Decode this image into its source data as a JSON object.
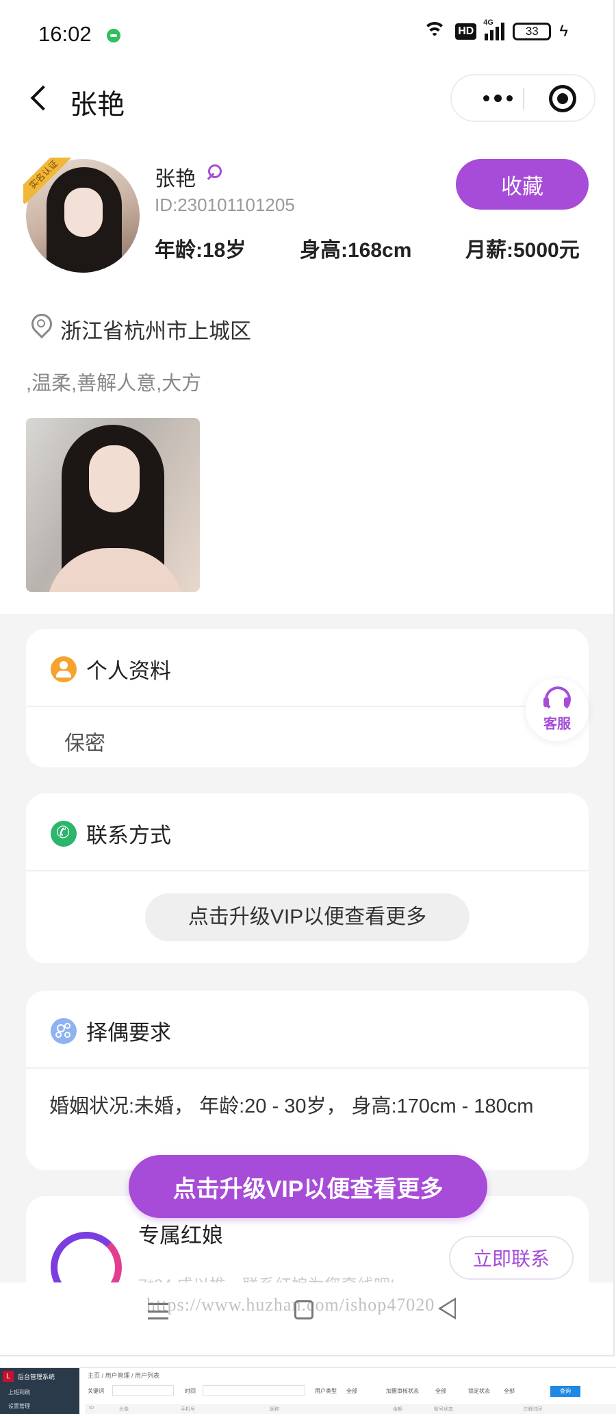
{
  "status_bar": {
    "time": "16:02",
    "hd": "HD",
    "network": "4G",
    "battery": "33",
    "icons": [
      "message-dot-icon",
      "wifi-icon",
      "hd-icon",
      "signal-icon",
      "battery-icon",
      "charging-icon"
    ]
  },
  "nav": {
    "title": "张艳",
    "icons": [
      "back-icon",
      "more-icon",
      "target-icon"
    ]
  },
  "profile": {
    "name": "张艳",
    "verify_badge": "实名认证",
    "id": "ID:230101101205",
    "favorite_label": "收藏",
    "age": "年龄:18岁",
    "height": "身高:168cm",
    "salary": "月薪:5000元",
    "location": "浙江省杭州市上城区",
    "tags": ",温柔,善解人意,大方"
  },
  "personal_info": {
    "title": "个人资料",
    "content": "保密"
  },
  "contact": {
    "title": "联系方式",
    "vip_prompt": "点击升级VIP以便查看更多"
  },
  "partner_requirements": {
    "title": "择偶要求",
    "content": "婚姻状况:未婚， 年龄:20 - 30岁， 身高:170cm - 180cm"
  },
  "matchmaker": {
    "title": "专属红娘",
    "subtitle": "7*24 成以推，联系红娘为您牵线吧!",
    "contact_label": "立即联系"
  },
  "floating": {
    "vip_button": "点击升级VIP以便查看更多",
    "service_label": "客服"
  },
  "watermark": "https://www.huzhan.com/ishop47020",
  "admin": {
    "system_name": "后台管理系统",
    "menu": [
      "上班到刷",
      "设置管理"
    ],
    "breadcrumb": "主页 / 用户管理 / 用户列表",
    "filters": [
      "关键词",
      "时间",
      "用户类型",
      "全部",
      "加盟审核状态",
      "全部",
      "锁定状态",
      "全部"
    ],
    "query_label": "查询",
    "table_headers": [
      "ID",
      "头像",
      "手机号",
      "昵称",
      "余额",
      "账号状态",
      "注册时间"
    ]
  },
  "colors": {
    "accent": "#a64cd8",
    "background_grey": "#f4f4f4",
    "person_icon": "#f4a32e",
    "phone_icon": "#2cb56b",
    "requirements_icon": "#8fb2f0"
  }
}
